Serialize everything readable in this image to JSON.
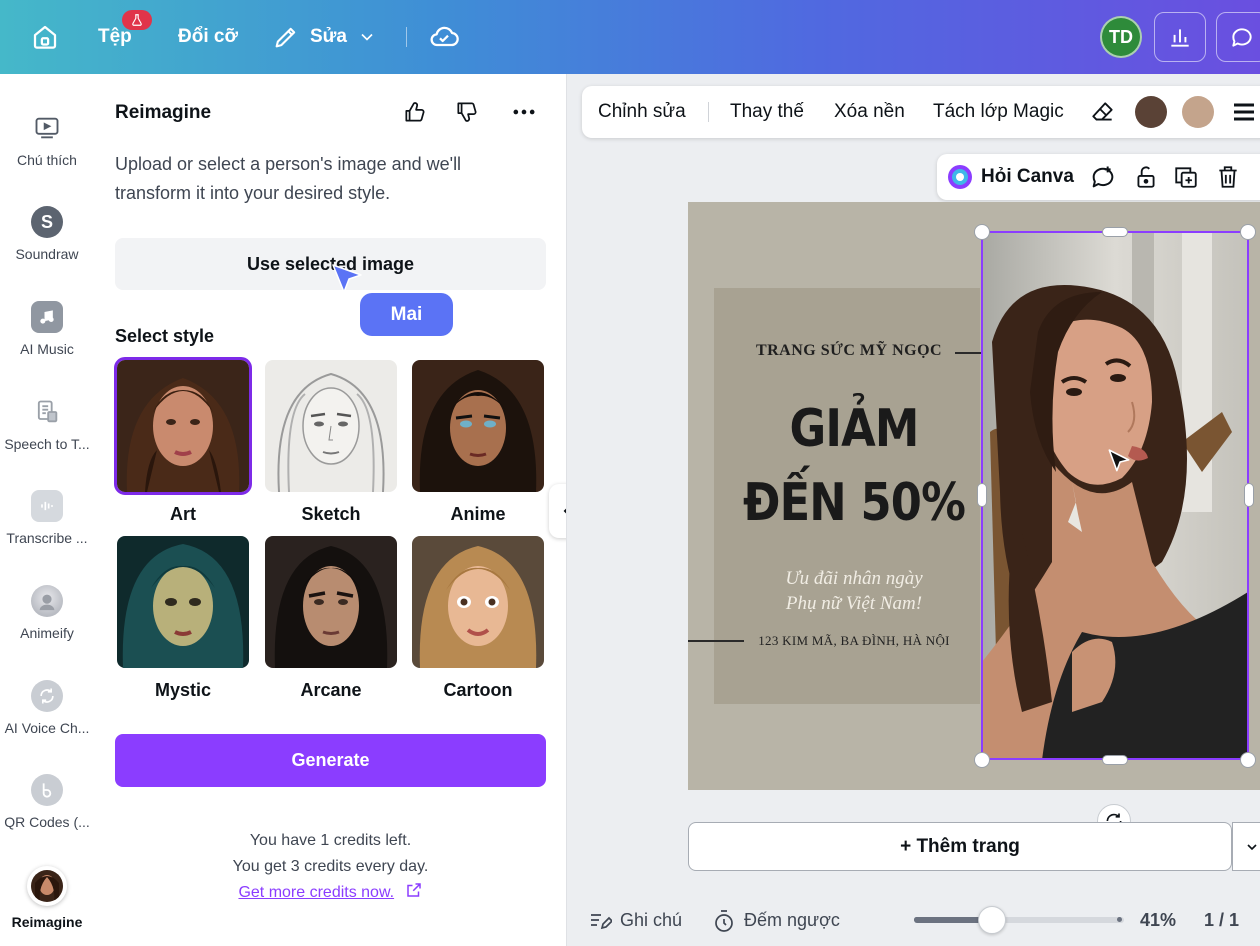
{
  "topbar": {
    "file_label": "Tệp",
    "resize_label": "Đổi cỡ",
    "edit_label": "Sửa",
    "avatar_initials": "TD"
  },
  "rail": {
    "items": [
      {
        "label": "Chú thích",
        "icon": "captions-icon"
      },
      {
        "label": "Soundraw",
        "icon": "soundraw-icon"
      },
      {
        "label": "AI Music",
        "icon": "music-note-icon"
      },
      {
        "label": "Speech to T...",
        "icon": "speech-to-text-icon"
      },
      {
        "label": "Transcribe ...",
        "icon": "transcribe-icon"
      },
      {
        "label": "Animeify",
        "icon": "animeify-icon"
      },
      {
        "label": "AI Voice Ch...",
        "icon": "voice-changer-icon"
      },
      {
        "label": "QR Codes (...",
        "icon": "qr-code-icon"
      },
      {
        "label": "Reimagine",
        "icon": "reimagine-icon"
      }
    ]
  },
  "panel": {
    "title": "Reimagine",
    "description": "Upload or select a person's image and we'll transform it into your desired style.",
    "use_selected": "Use selected image",
    "select_style": "Select style",
    "styles": [
      {
        "name": "Art",
        "selected": true
      },
      {
        "name": "Sketch"
      },
      {
        "name": "Anime"
      },
      {
        "name": "Mystic"
      },
      {
        "name": "Arcane"
      },
      {
        "name": "Cartoon"
      }
    ],
    "generate": "Generate",
    "credits_line1": "You have 1 credits left.",
    "credits_line2": "You get 3 credits every day.",
    "credits_link": "Get more credits now."
  },
  "collaborator": {
    "name": "Mai",
    "color": "#5b73f5"
  },
  "context_toolbar": {
    "edit": "Chỉnh sửa",
    "replace": "Thay thế",
    "remove_bg": "Xóa nền",
    "magic_layers": "Tách lớp Magic",
    "swatch_colors": [
      "#5a4236",
      "#c4a48c"
    ]
  },
  "float_bar": {
    "ask_canva": "Hỏi Canva"
  },
  "design": {
    "brand": "TRANG SỨC MỸ NGỌC",
    "headline_1": "GIẢM",
    "headline_2": "ĐẾN 50%",
    "promo_1": "Ưu đãi nhân ngày",
    "promo_2": "Phụ nữ Việt Nam!",
    "address": "123 KIM MÃ, BA ĐÌNH, HÀ NỘI"
  },
  "canvas": {
    "add_page": "+ Thêm trang"
  },
  "bottom": {
    "notes": "Ghi chú",
    "timer": "Đếm ngược",
    "zoom": "41%",
    "zoom_value": 41,
    "pages": "1 / 1"
  },
  "colors": {
    "accent": "#8b3dff"
  }
}
